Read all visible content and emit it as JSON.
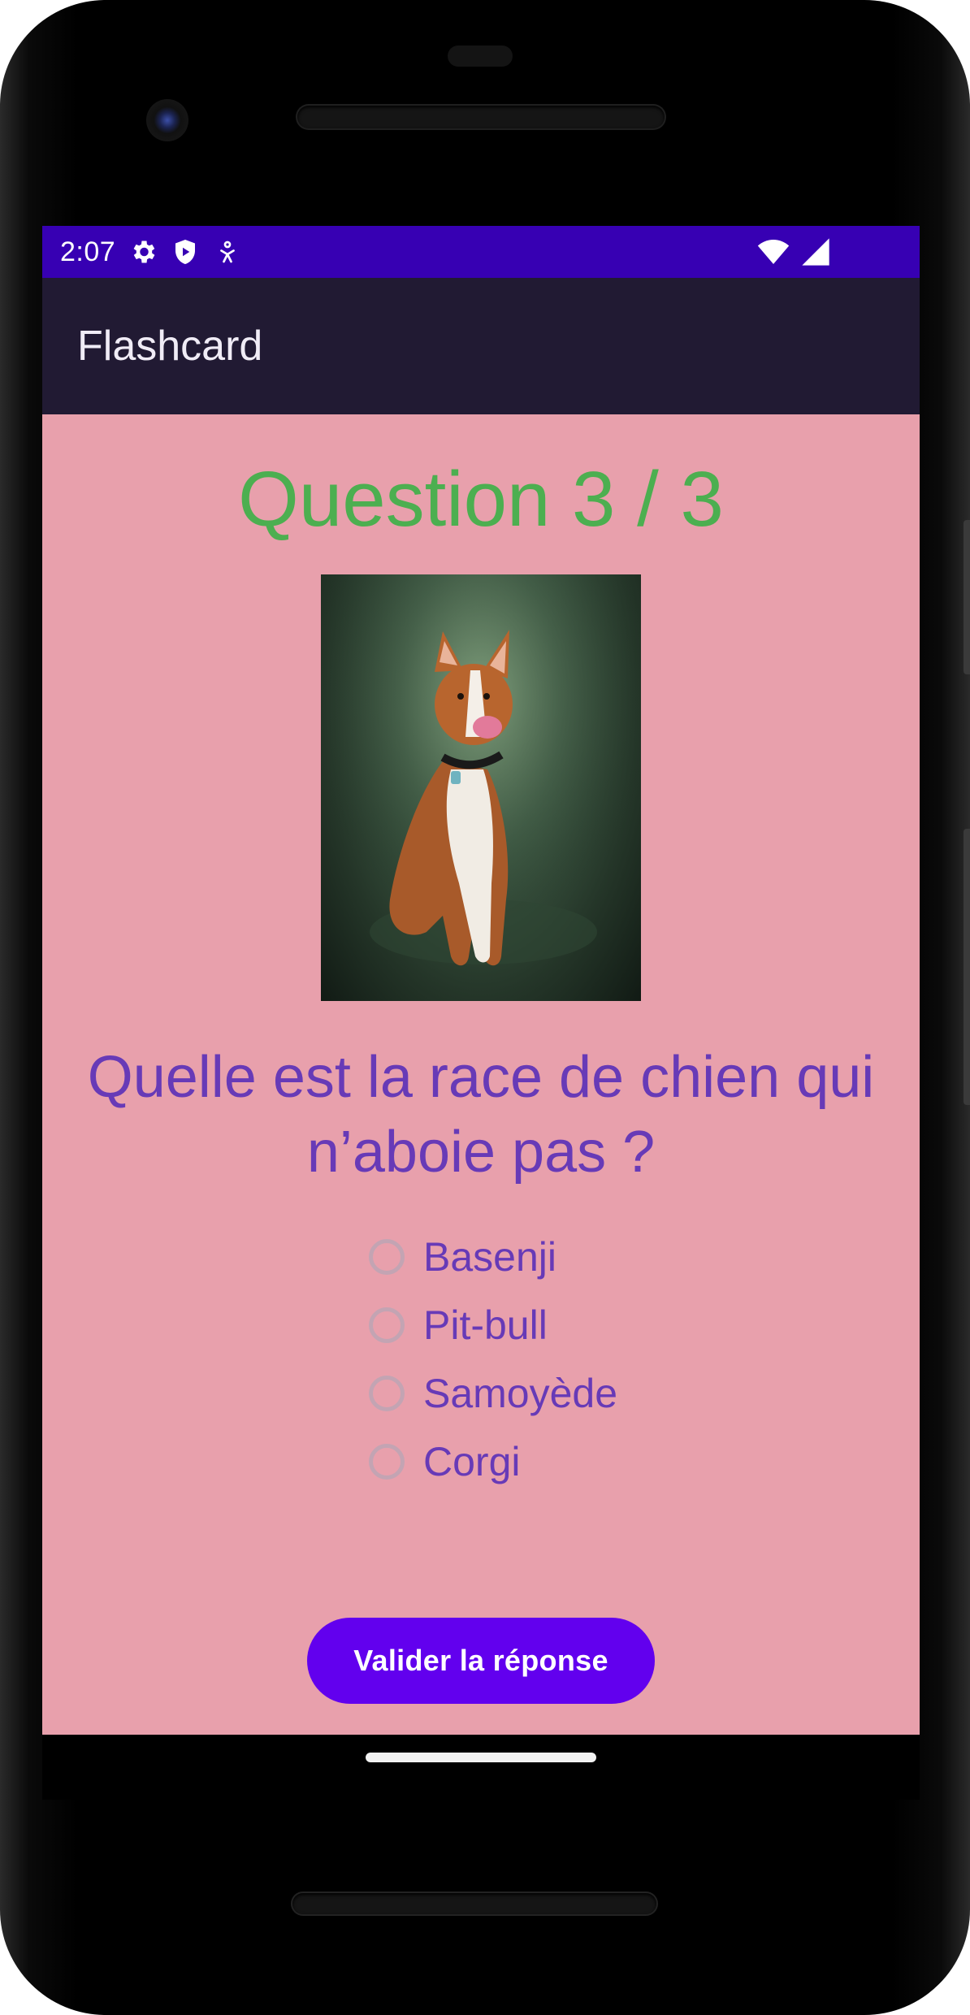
{
  "status_bar": {
    "time": "2:07",
    "left_icons": [
      "gear-icon",
      "shield-icon",
      "accessibility-icon"
    ],
    "right_icons": [
      "wifi-icon",
      "signal-icon"
    ],
    "color": "#3700b3"
  },
  "app_bar": {
    "title": "Flashcard",
    "color": "#211a33"
  },
  "quiz": {
    "counter": "Question 3 / 3",
    "image": "dog-photo",
    "question": "Quelle est la race de chien qui n’aboie pas ?",
    "options": [
      {
        "label": "Basenji",
        "selected": false
      },
      {
        "label": "Pit-bull",
        "selected": false
      },
      {
        "label": "Samoyède",
        "selected": false
      },
      {
        "label": "Corgi",
        "selected": false
      }
    ],
    "submit_label": "Valider la réponse",
    "background": "#e8a0ac",
    "counter_color": "#4caf50",
    "text_color": "#673ab7",
    "button_color": "#6200ee"
  }
}
